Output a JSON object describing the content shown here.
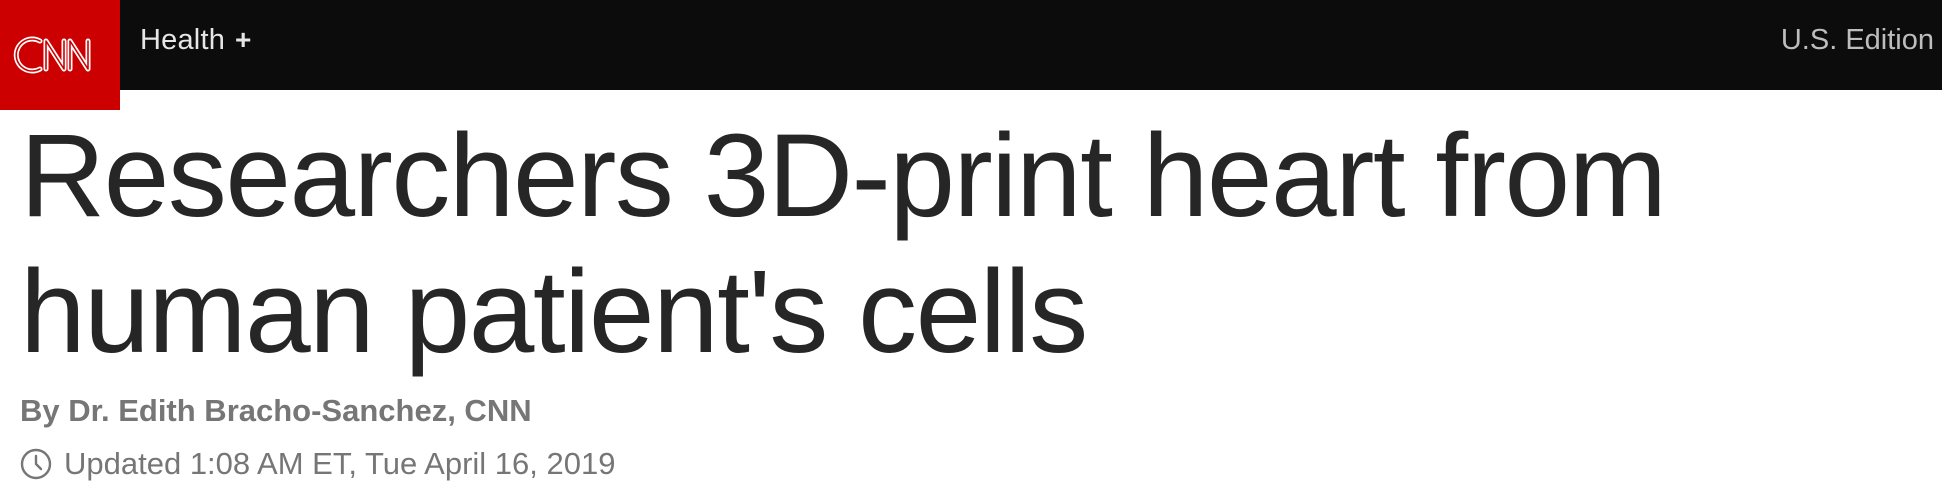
{
  "header": {
    "logo_text": "CNN",
    "section": "Health",
    "section_plus": "+",
    "edition": "U.S. Edition"
  },
  "article": {
    "headline": "Researchers 3D-print heart from human patient's cells",
    "byline": "By Dr. Edith Bracho-Sanchez, CNN",
    "updated": "Updated 1:08 AM ET, Tue April 16, 2019"
  },
  "colors": {
    "brand_red": "#cc0000",
    "topbar": "#0c0c0c",
    "headline": "#262626",
    "meta": "#767676"
  },
  "icons": {
    "logo": "cnn-logo",
    "expand": "plus-icon",
    "time": "clock-icon"
  }
}
